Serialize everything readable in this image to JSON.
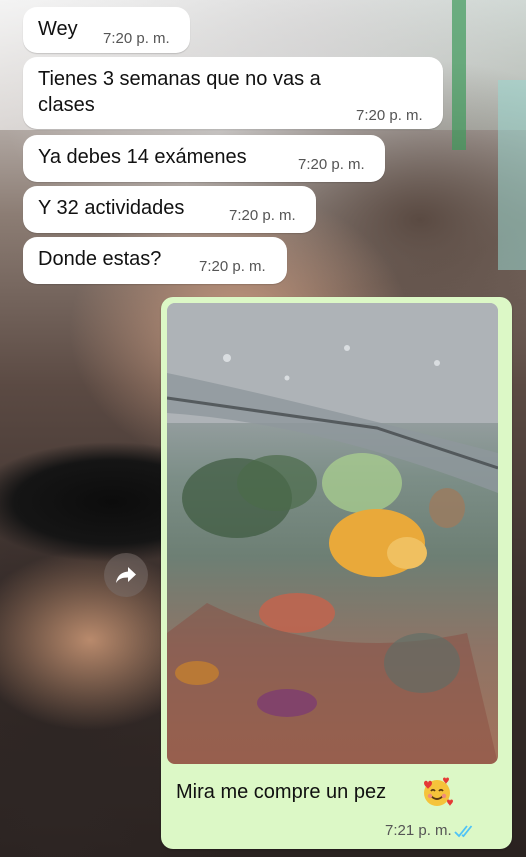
{
  "messages": [
    {
      "text": "Wey",
      "time": "7:20 p. m."
    },
    {
      "text": "Tienes 3 semanas que no vas a clases",
      "time": "7:20 p. m."
    },
    {
      "text": "Ya debes 14 exámenes",
      "time": "7:20 p. m."
    },
    {
      "text": "Y 32 actividades",
      "time": "7:20 p. m."
    },
    {
      "text": "Donde estas?",
      "time": "7:20 p. m."
    }
  ],
  "sent": {
    "caption": "Mira me compre un pez",
    "time": "7:21 p. m.",
    "emoji": "smiling-face-with-hearts-icon",
    "status": "read-double-check-icon",
    "status_color": "#4fc3f7"
  },
  "colors": {
    "incoming_bubble": "#ffffff",
    "outgoing_bubble": "#dcf8c6"
  },
  "icons": {
    "forward": "forward-arrow-icon"
  }
}
